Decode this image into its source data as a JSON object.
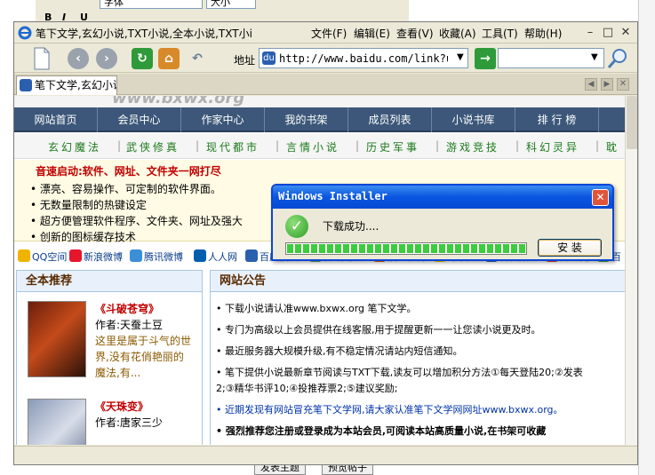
{
  "background": {
    "font_select": "字体",
    "size_select": "大小",
    "format_bold": "B",
    "format_italic": "I",
    "format_underline": "U",
    "post_button": "发表主题",
    "preview_button": "预览帖子"
  },
  "browser": {
    "title": "笔下文学,玄幻小说,TXT小说,全本小说,TXT小i",
    "menu": [
      "文件(F)",
      "编辑(E)",
      "查看(V)",
      "收藏(A)",
      "工具(T)",
      "帮助(H)"
    ],
    "address_label": "地址",
    "address_url": "http://www.baidu.com/link?ur",
    "tab_title": "笔下文学,玄幻小说",
    "colors": {
      "chrome": "#ece9d8",
      "nav_bar": "#3c5779",
      "dialog_border": "#0a46d7"
    }
  },
  "page": {
    "logo": "www.bxwx.org",
    "nav_main": [
      "网站首页",
      "会员中心",
      "作家中心",
      "我的书架",
      "成员列表",
      "小说书库",
      "排 行 榜"
    ],
    "nav_genres": [
      "玄幻魔法",
      "武侠修真",
      "现代都市",
      "言情小说",
      "历史军事",
      "游戏竞技",
      "科幻灵异",
      "耽"
    ],
    "promo": {
      "title": "音速启动:软件、网址、文件夹一网打尽",
      "items": [
        "漂亮、容易操作、可定制的软件界面。",
        "无数量限制的热键设定",
        "超方便管理软件程序、文件夹、网址及强大",
        "创新的图标缓存技术"
      ]
    },
    "share_links": [
      "QQ空间",
      "新浪微博",
      "腾讯微博",
      "人人网",
      "百度搜藏",
      "腾讯朋友",
      "搜狐微博",
      "QQ收藏",
      "百度贴吧",
      "开心网",
      "百"
    ],
    "recommend": {
      "heading": "全本推荐",
      "books": [
        {
          "name": "《斗破苍穹》",
          "author": "作者:天蚕土豆",
          "desc": "这里是属于斗气的世界,没有花俏艳丽的魔法,有..."
        },
        {
          "name": "《天珠变》",
          "author": "作者:唐家三少",
          "desc": ""
        }
      ]
    },
    "announcement": {
      "heading": "网站公告",
      "items": [
        "下载小说请认准www.bxwx.org 笔下文学。",
        "专门为高级以上会员提供在线客服,用于提醒更新一一让您读小说更及时。",
        "最近服务器大规模升级,有不稳定情况请站内短信通知。",
        "笔下提供小说最新章节阅读与TXT下载,读友可以增加积分方法①每天登陆20;②发表",
        "2;③精华书评10;④投推荐票2;⑤建议奖励;",
        "近期发现有网站冒充笔下文学网,请大家认准笔下文学网网址www.bxwx.org。",
        "强烈推荐您注册或登录成为本站会员,可阅读本站高质量小说,在书架可收藏"
      ]
    }
  },
  "dialog": {
    "title": "Windows Installer",
    "message": "下载成功....",
    "progress": 1.0,
    "install_button": "安 装",
    "close_glyph": "✕"
  }
}
